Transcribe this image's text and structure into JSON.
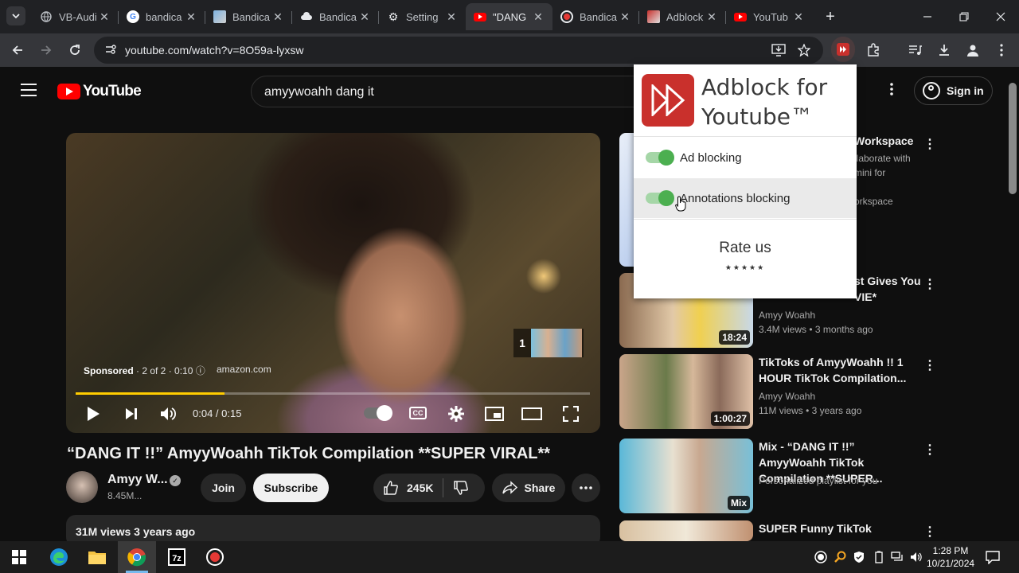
{
  "browser": {
    "tabs": [
      {
        "title": "VB-Audi",
        "icon": "globe-icon",
        "active": false
      },
      {
        "title": "bandica",
        "icon": "google-icon",
        "active": false
      },
      {
        "title": "Bandica",
        "icon": "bandicam-page-icon",
        "active": false
      },
      {
        "title": "Bandica",
        "icon": "cloud-icon",
        "active": false
      },
      {
        "title": "Setting",
        "icon": "gear-icon",
        "active": false
      },
      {
        "title": "\"DANG",
        "icon": "youtube-icon",
        "active": true
      },
      {
        "title": "Bandica",
        "icon": "record-icon",
        "active": false
      },
      {
        "title": "Adblock",
        "icon": "adblock-icon",
        "active": false
      },
      {
        "title": "YouTub",
        "icon": "youtube-icon",
        "active": false
      }
    ],
    "url": "youtube.com/watch?v=8O59a-lyxsw"
  },
  "youtube": {
    "logo_text": "YouTube",
    "search_query": "amyywoahh dang it",
    "sign_in_label": "Sign in",
    "player": {
      "sponsored_label": "Sponsored",
      "sponsored_detail": " · 2 of 2 · 0:10",
      "ad_domain": "amazon.com",
      "ad_queue_count": "1",
      "time": "0:04 / 0:15",
      "progress": 0.29
    },
    "video": {
      "title": "“DANG IT !!” AmyyWoahh TikTok Compilation **SUPER VIRAL**",
      "channel": "Amyy W...",
      "subscribers": "8.45M...",
      "join_label": "Join",
      "subscribe_label": "Subscribe",
      "likes": "245K",
      "share_label": "Share",
      "views_line": "31M views  3 years ago"
    },
    "recommendations": [
      {
        "title": "Workspace",
        "line2": "llaborate with",
        "line3": "mini for",
        "line4": "orkspace"
      },
      {
        "title_line1": "st Gives You",
        "title_line2": "VIE*",
        "channel": "Amyy Woahh",
        "meta": "3.4M views  • 3 months ago",
        "duration": "18:24"
      },
      {
        "title": "TikToks of AmyyWoahh !! 1 HOUR TikTok Compilation...",
        "channel": "Amyy Woahh",
        "meta": "11M views  • 3 years ago",
        "duration": "1:00:27"
      },
      {
        "title": "Mix - “DANG IT !!” AmyyWoahh TikTok Compilation **SUPER...",
        "meta": "Personalized playlist for you",
        "duration": "Mix"
      },
      {
        "title": "SUPER Funny TikTok",
        "meta": ""
      }
    ]
  },
  "popup": {
    "title_line1": "Adblock for",
    "title_line2": "Youtube™",
    "ad_blocking_label": "Ad blocking",
    "ad_blocking_on": true,
    "annotations_label": "Annotations blocking",
    "annotations_on": true,
    "rate_label": "Rate us",
    "stars": "★★★★★"
  },
  "taskbar": {
    "time": "1:28 PM",
    "date": "10/21/2024"
  },
  "colors": {
    "youtube_red": "#ff0000",
    "adblock_red": "#c9302c",
    "toggle_green": "#4caf50",
    "ad_progress": "#ffcc00"
  }
}
